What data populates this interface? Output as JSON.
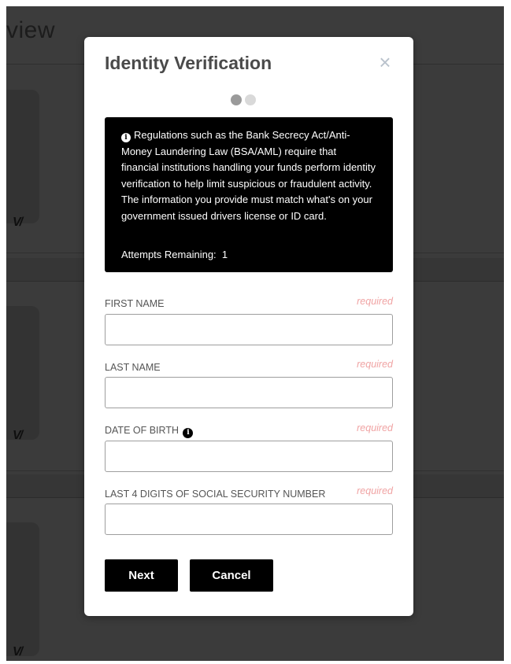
{
  "background": {
    "title_fragment": "view",
    "logo_text": "V/"
  },
  "modal": {
    "title": "Identity Verification",
    "close_symbol": "×",
    "steps": {
      "total": 2,
      "current": 1
    },
    "info": {
      "icon": "info-icon",
      "text": "Regulations such as the Bank Secrecy Act/Anti-Money Laundering Law (BSA/AML) require that financial institutions handling your funds perform identity verification to help limit suspicious or fraudulent activity. The information you provide must match what's on your government issued drivers license or ID card.",
      "attempts_label": "Attempts Remaining:",
      "attempts_value": "1"
    },
    "fields": {
      "first_name": {
        "label": "FIRST NAME",
        "required": "required",
        "value": ""
      },
      "last_name": {
        "label": "LAST NAME",
        "required": "required",
        "value": ""
      },
      "dob": {
        "label": "DATE OF BIRTH",
        "required": "required",
        "value": ""
      },
      "ssn4": {
        "label": "LAST 4 DIGITS OF SOCIAL SECURITY NUMBER",
        "required": "required",
        "value": ""
      }
    },
    "buttons": {
      "next": "Next",
      "cancel": "Cancel"
    }
  },
  "colors": {
    "overlay": "#3b3b3b",
    "required": "#f0a3a3",
    "button": "#000000"
  }
}
